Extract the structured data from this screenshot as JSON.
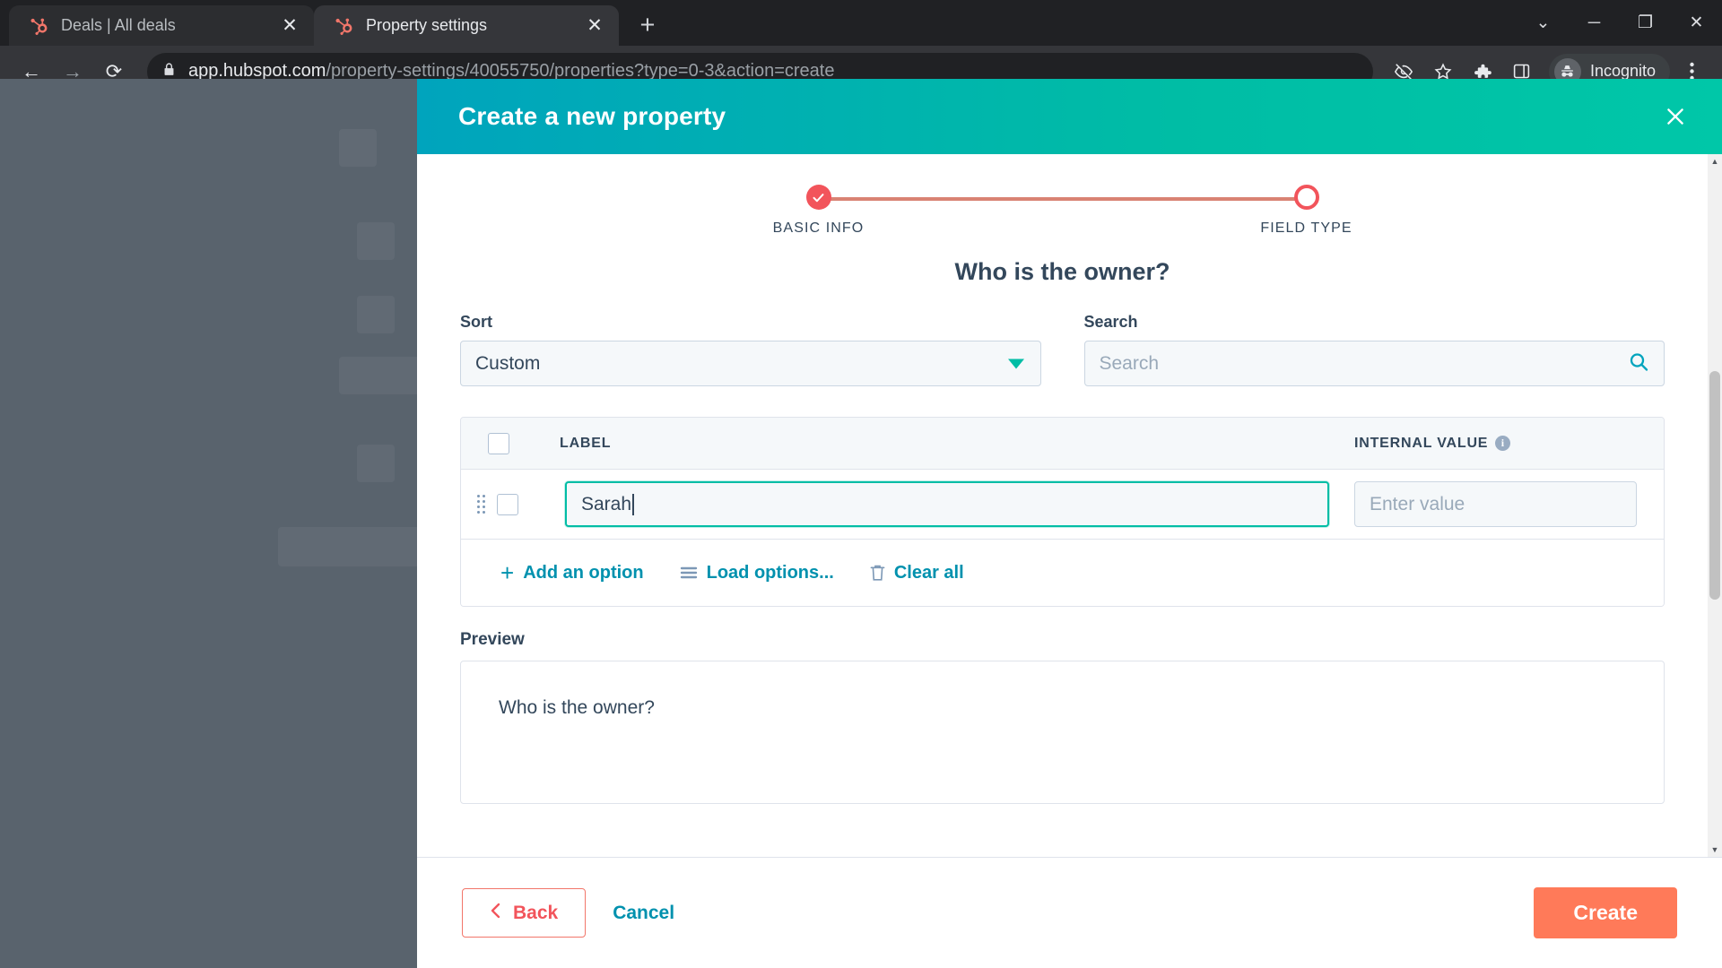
{
  "browser": {
    "tabs": [
      {
        "title": "Deals | All deals",
        "favicon": "hubspot-icon",
        "active": false
      },
      {
        "title": "Property settings",
        "favicon": "hubspot-icon",
        "active": true
      }
    ],
    "new_tab_label": "+",
    "window_controls": {
      "minimize_all": "⌄",
      "minimize": "─",
      "maximize": "❐",
      "close": "✕"
    },
    "nav": {
      "back": "←",
      "forward": "→",
      "reload": "⟳"
    },
    "omnibox": {
      "lock_icon": "lock-icon",
      "url_domain": "app.hubspot.com",
      "url_path": "/property-settings/40055750/properties?type=0-3&action=create"
    },
    "toolbar_icons": [
      "eye-off-icon",
      "star-icon",
      "extensions-icon",
      "side-panel-icon"
    ],
    "profile": {
      "label": "Incognito",
      "icon": "incognito-avatar"
    },
    "menu_icon": "kebab-menu-icon"
  },
  "modal": {
    "title": "Create a new property",
    "close_icon": "close-icon",
    "stepper": {
      "steps": [
        {
          "label": "BASIC INFO",
          "state": "done",
          "icon": "check-icon"
        },
        {
          "label": "FIELD TYPE",
          "state": "current",
          "icon": "circle-icon"
        }
      ],
      "line_color": "#d98273",
      "accent_color": "#f2545b"
    },
    "question": "Who is the owner?",
    "sort": {
      "label": "Sort",
      "value": "Custom",
      "caret_icon": "chevron-down-icon"
    },
    "search": {
      "label": "Search",
      "placeholder": "Search",
      "icon": "search-icon"
    },
    "options_table": {
      "columns": {
        "label": "LABEL",
        "internal_value": "INTERNAL VALUE",
        "info_icon": "info-icon"
      },
      "select_all_checkbox": false,
      "rows": [
        {
          "drag_handle": "drag-handle-icon",
          "selected": false,
          "label_value": "Sarah",
          "label_focused": true,
          "internal_value": "",
          "internal_placeholder": "Enter value"
        }
      ],
      "actions": [
        {
          "label": "Add an option",
          "icon": "plus-icon"
        },
        {
          "label": "Load options...",
          "icon": "list-icon"
        },
        {
          "label": "Clear all",
          "icon": "trash-icon"
        }
      ]
    },
    "preview": {
      "label": "Preview",
      "question": "Who is the owner?"
    },
    "footer": {
      "back": {
        "label": "Back",
        "icon": "chevron-left-icon"
      },
      "cancel": "Cancel",
      "create": "Create"
    },
    "colors": {
      "header_gradient_start": "#00a4bd",
      "header_gradient_end": "#00c7a8",
      "teal": "#00bda5",
      "link": "#0091ae",
      "primary_button": "#ff7a59",
      "text": "#33475b"
    }
  }
}
